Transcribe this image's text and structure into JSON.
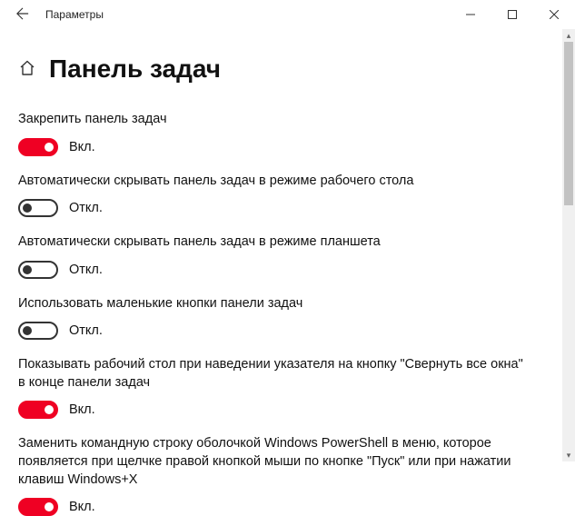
{
  "window": {
    "title": "Параметры"
  },
  "page": {
    "heading": "Панель задач"
  },
  "labels": {
    "on": "Вкл.",
    "off": "Откл."
  },
  "settings": [
    {
      "label": "Закрепить панель задач",
      "value": true
    },
    {
      "label": "Автоматически скрывать панель задач в режиме рабочего стола",
      "value": false
    },
    {
      "label": "Автоматически скрывать панель задач в режиме планшета",
      "value": false
    },
    {
      "label": "Использовать маленькие кнопки панели задач",
      "value": false
    },
    {
      "label": "Показывать рабочий стол при наведении указателя на кнопку \"Свернуть все окна\" в конце панели задач",
      "value": true
    },
    {
      "label": "Заменить командную строку оболочкой Windows PowerShell в меню, которое появляется при щелчке правой кнопкой мыши по кнопке \"Пуск\" или при нажатии клавиш Windows+X",
      "value": true
    }
  ]
}
